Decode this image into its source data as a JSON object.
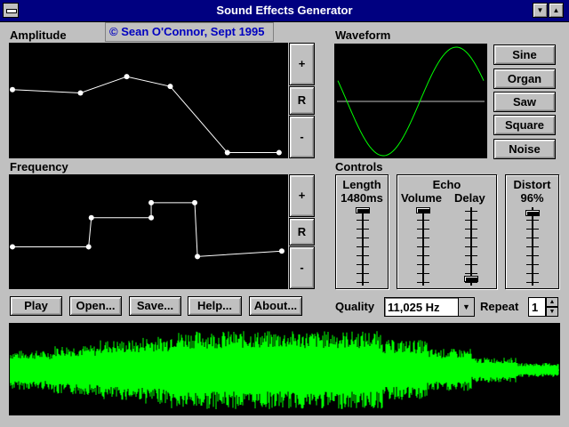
{
  "window": {
    "title": "Sound Effects Generator"
  },
  "copyright": "© Sean O'Connor, Sept 1995",
  "amplitude": {
    "label": "Amplitude",
    "buttons": {
      "plus": "+",
      "reset": "R",
      "minus": "-"
    },
    "points": [
      [
        0,
        0.6
      ],
      [
        0.25,
        0.57
      ],
      [
        0.42,
        0.72
      ],
      [
        0.58,
        0.63
      ],
      [
        0.79,
        0.02
      ],
      [
        0.98,
        0.02
      ]
    ]
  },
  "frequency": {
    "label": "Frequency",
    "buttons": {
      "plus": "+",
      "reset": "R",
      "minus": "-"
    },
    "points": [
      [
        0,
        0.36
      ],
      [
        0.28,
        0.36
      ],
      [
        0.29,
        0.63
      ],
      [
        0.51,
        0.63
      ],
      [
        0.51,
        0.77
      ],
      [
        0.67,
        0.77
      ],
      [
        0.68,
        0.27
      ],
      [
        0.99,
        0.32
      ]
    ]
  },
  "waveform": {
    "label": "Waveform",
    "buttons": [
      "Sine",
      "Organ",
      "Saw",
      "Square",
      "Noise"
    ],
    "selected": "Sine"
  },
  "controls": {
    "label": "Controls",
    "length": {
      "title": "Length",
      "value": "1480ms",
      "level": 1.0
    },
    "echo": {
      "title": "Echo",
      "volume": {
        "label": "Volume",
        "level": 1.0
      },
      "delay": {
        "label": "Delay",
        "level": 0.05
      }
    },
    "distort": {
      "title": "Distort",
      "value": "96%",
      "level": 0.96
    }
  },
  "toolbar": {
    "play": "Play",
    "open": "Open...",
    "save": "Save...",
    "help": "Help...",
    "about": "About..."
  },
  "quality": {
    "label": "Quality",
    "value": "11,025 Hz"
  },
  "repeat": {
    "label": "Repeat",
    "value": "1"
  },
  "colors": {
    "titlebar": "#000080",
    "trace": "#00ff00",
    "curve": "#ffffff"
  },
  "icons": {
    "sysmenu": "system-menu-icon",
    "minimize": "minimize-icon",
    "maximize": "maximize-icon"
  }
}
